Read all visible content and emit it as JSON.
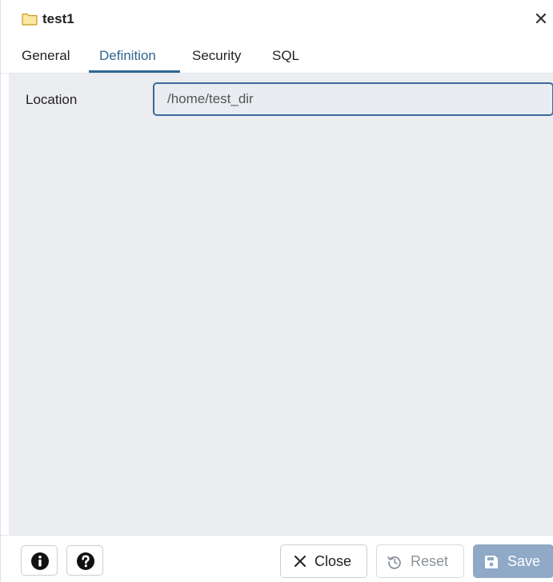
{
  "dialog": {
    "title": "test1",
    "title_icon": "folder-icon",
    "close_icon": "close-icon"
  },
  "tabs": [
    {
      "label": "General"
    },
    {
      "label": "Definition"
    },
    {
      "label": "Security"
    },
    {
      "label": "SQL"
    }
  ],
  "active_tab": "Definition",
  "form": {
    "location_label": "Location",
    "location_value": "/home/test_dir"
  },
  "footer": {
    "info_icon": "info-icon",
    "help_icon": "help-icon",
    "close_label": "Close",
    "reset_label": "Reset",
    "save_label": "Save"
  },
  "colors": {
    "accent": "#326690",
    "input_border": "#3a6a9a",
    "content_bg": "#ebedf0",
    "save_bg": "#8fa9c6",
    "folder_icon": "#f2c94c"
  }
}
